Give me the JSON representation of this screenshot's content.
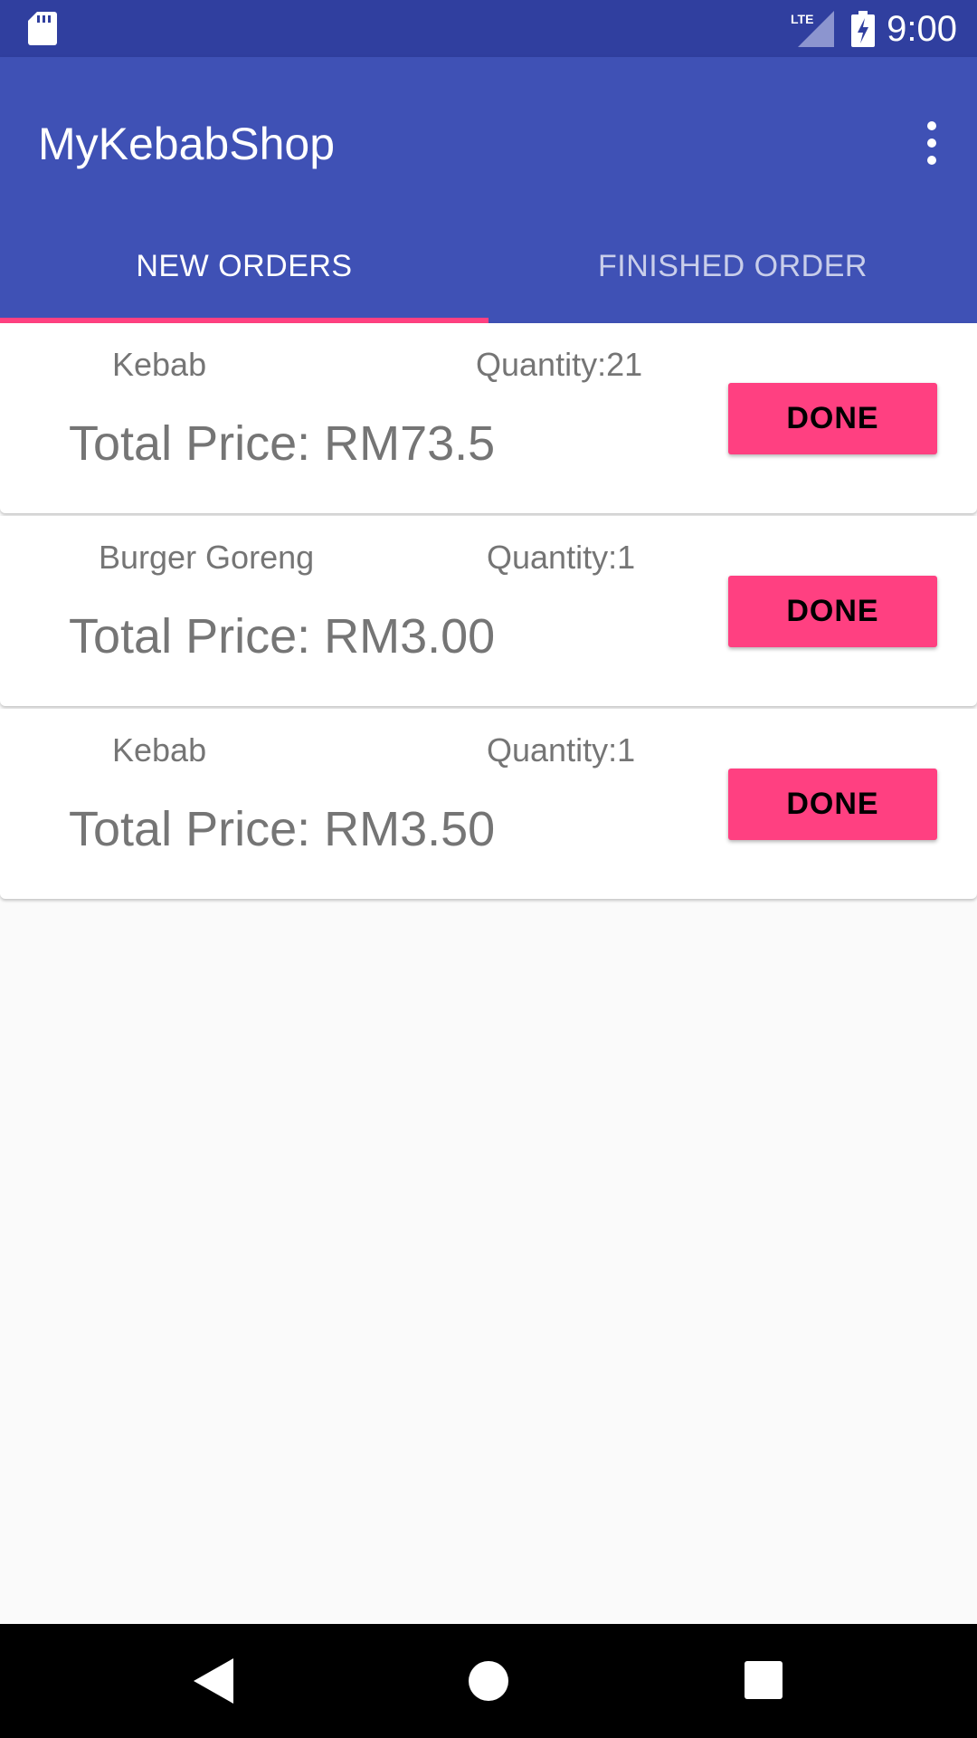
{
  "status_bar": {
    "time": "9:00",
    "network_label": "LTE",
    "icons": [
      "sd-card-icon",
      "lte-signal-icon",
      "battery-charging-icon"
    ]
  },
  "app_bar": {
    "title": "MyKebabShop",
    "overflow_icon": "more-vert-icon"
  },
  "tabs": [
    {
      "label": "NEW ORDERS",
      "selected": true
    },
    {
      "label": "FINISHED ORDER",
      "selected": false
    }
  ],
  "orders": [
    {
      "item": "Kebab",
      "quantity": "Quantity:21",
      "total": "Total Price: RM73.5",
      "button": "DONE"
    },
    {
      "item": "Burger Goreng",
      "quantity": "Quantity:1",
      "total": "Total Price: RM3.00",
      "button": "DONE"
    },
    {
      "item": "Kebab",
      "quantity": "Quantity:1",
      "total": "Total Price: RM3.50",
      "button": "DONE"
    }
  ],
  "nav_bar": {
    "icons": [
      "back-icon",
      "home-icon",
      "recents-icon"
    ]
  },
  "colors": {
    "status_bar": "#303f9f",
    "primary": "#3f51b5",
    "accent": "#ff4081",
    "background": "#fafafa",
    "secondary_text": "#757575"
  }
}
